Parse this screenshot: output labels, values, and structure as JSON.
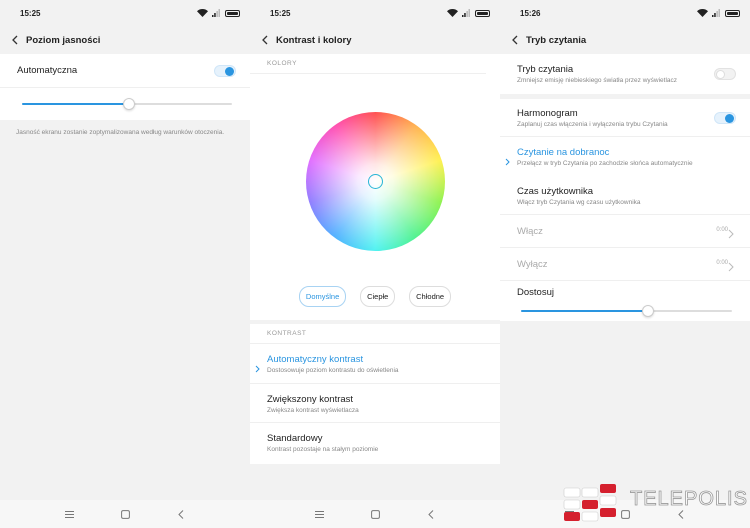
{
  "screen1": {
    "time": "15:25",
    "title": "Poziom jasności",
    "auto_label": "Automatyczna",
    "auto_on": true,
    "brightness_level": 0.51,
    "note": "Jasność ekranu zostanie zoptymalizowana według warunków otoczenia."
  },
  "screen2": {
    "time": "15:25",
    "title": "Kontrast i kolory",
    "colors_section": "KOLORY",
    "color_buttons": [
      "Domyślne",
      "Ciepłe",
      "Chłodne"
    ],
    "contrast_section": "KONTRAST",
    "contrast_items": [
      {
        "title": "Automatyczny kontrast",
        "sub": "Dostosowuje poziom kontrastu do oświetlenia"
      },
      {
        "title": "Zwiększony kontrast",
        "sub": "Zwiększa kontrast wyświetlacza"
      },
      {
        "title": "Standardowy",
        "sub": "Kontrast pozostaje na stałym poziomie"
      }
    ]
  },
  "screen3": {
    "time": "15:26",
    "title": "Tryb czytania",
    "reading_title": "Tryb czytania",
    "reading_sub": "Zmniejsz emisję niebieskiego światła przez wyświetlacz",
    "reading_on": false,
    "schedule_title": "Harmonogram",
    "schedule_sub": "Zaplanuj czas włączenia i wyłączenia trybu Czytania",
    "schedule_on": true,
    "night_title": "Czytanie na dobranoc",
    "night_sub": "Przełącz w tryb Czytania po zachodzie słońca automatycznie",
    "user_title": "Czas użytkownika",
    "user_sub": "Włącz tryb Czytania wg czasu użytkownika",
    "on_label": "Włącz",
    "on_value": "0:00",
    "off_label": "Wyłącz",
    "off_value": "0:00",
    "adjust_label": "Dostosuj",
    "adjust_level": 0.6
  },
  "watermark": "TELEPOLIS",
  "colors": {
    "accent": "#2a95e0",
    "watermark_red": "#d5202e"
  }
}
